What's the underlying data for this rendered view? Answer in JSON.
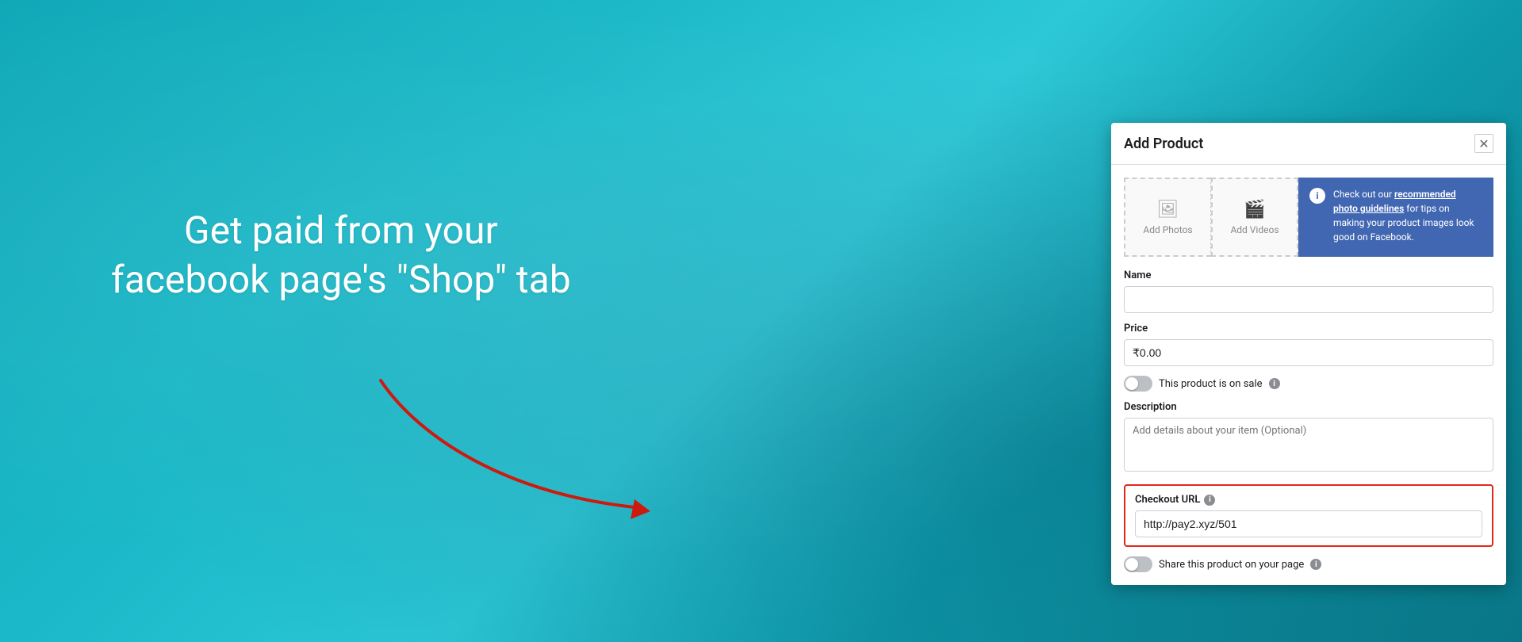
{
  "background": {
    "gradient_start": "#0fa8b8",
    "gradient_end": "#0a7a8a"
  },
  "hero": {
    "line1": "Get paid from your",
    "line2": "facebook page's \"Shop\" tab"
  },
  "modal": {
    "title": "Add Product",
    "close_label": "✕",
    "upload_photos_label": "Add Photos",
    "upload_videos_label": "Add Videos",
    "info_text_prefix": "Check out our ",
    "info_link_text": "recommended photo guidelines",
    "info_text_suffix": " for tips on making your product images look good on Facebook.",
    "name_label": "Name",
    "name_placeholder": "",
    "price_label": "Price",
    "price_value": "₹0.00",
    "sale_toggle_label": "This product is on sale",
    "sale_info_icon": "i",
    "description_label": "Description",
    "description_placeholder": "Add details about your item (Optional)",
    "checkout_label": "Checkout URL",
    "checkout_info_icon": "i",
    "checkout_value": "http://pay2.xyz/501",
    "share_label": "Share this product on your page",
    "share_info_icon": "i"
  }
}
